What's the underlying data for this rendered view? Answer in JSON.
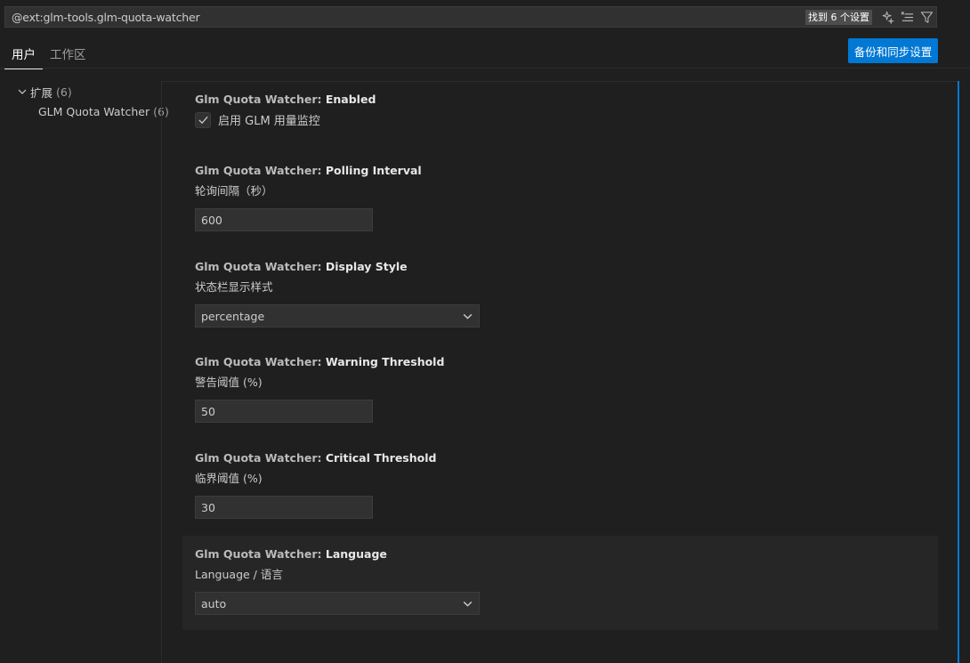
{
  "search": {
    "value": "@ext:glm-tools.glm-quota-watcher",
    "result_count": "找到 6 个设置",
    "icons": [
      "sparkle-icon",
      "clear-filter-icon",
      "filter-icon"
    ]
  },
  "tabs": [
    {
      "label": "用户",
      "active": true
    },
    {
      "label": "工作区",
      "active": false
    }
  ],
  "sync_button": {
    "label": "备份和同步设置"
  },
  "toc": {
    "group": {
      "label": "扩展",
      "count": "(6)"
    },
    "child": {
      "label": "GLM Quota Watcher",
      "count": "(6)"
    }
  },
  "settings": [
    {
      "category": "Glm Quota Watcher: ",
      "name": "Enabled",
      "type": "checkbox",
      "checked": true,
      "checkbox_label": "启用 GLM 用量监控"
    },
    {
      "category": "Glm Quota Watcher: ",
      "name": "Polling Interval",
      "type": "number",
      "description": "轮询间隔（秒）",
      "value": "600"
    },
    {
      "category": "Glm Quota Watcher: ",
      "name": "Display Style",
      "type": "select",
      "description": "状态栏显示样式",
      "value": "percentage"
    },
    {
      "category": "Glm Quota Watcher: ",
      "name": "Warning Threshold",
      "type": "number",
      "description": "警告阈值 (%)",
      "value": "50"
    },
    {
      "category": "Glm Quota Watcher: ",
      "name": "Critical Threshold",
      "type": "number",
      "description": "临界阈值 (%)",
      "value": "30"
    },
    {
      "category": "Glm Quota Watcher: ",
      "name": "Language",
      "type": "select",
      "description": "Language / 语言",
      "value": "auto"
    }
  ],
  "colors": {
    "background": "#1f1f1f",
    "accent": "#0078d4",
    "input_background": "#313131",
    "focused_border": "#0078d4"
  }
}
